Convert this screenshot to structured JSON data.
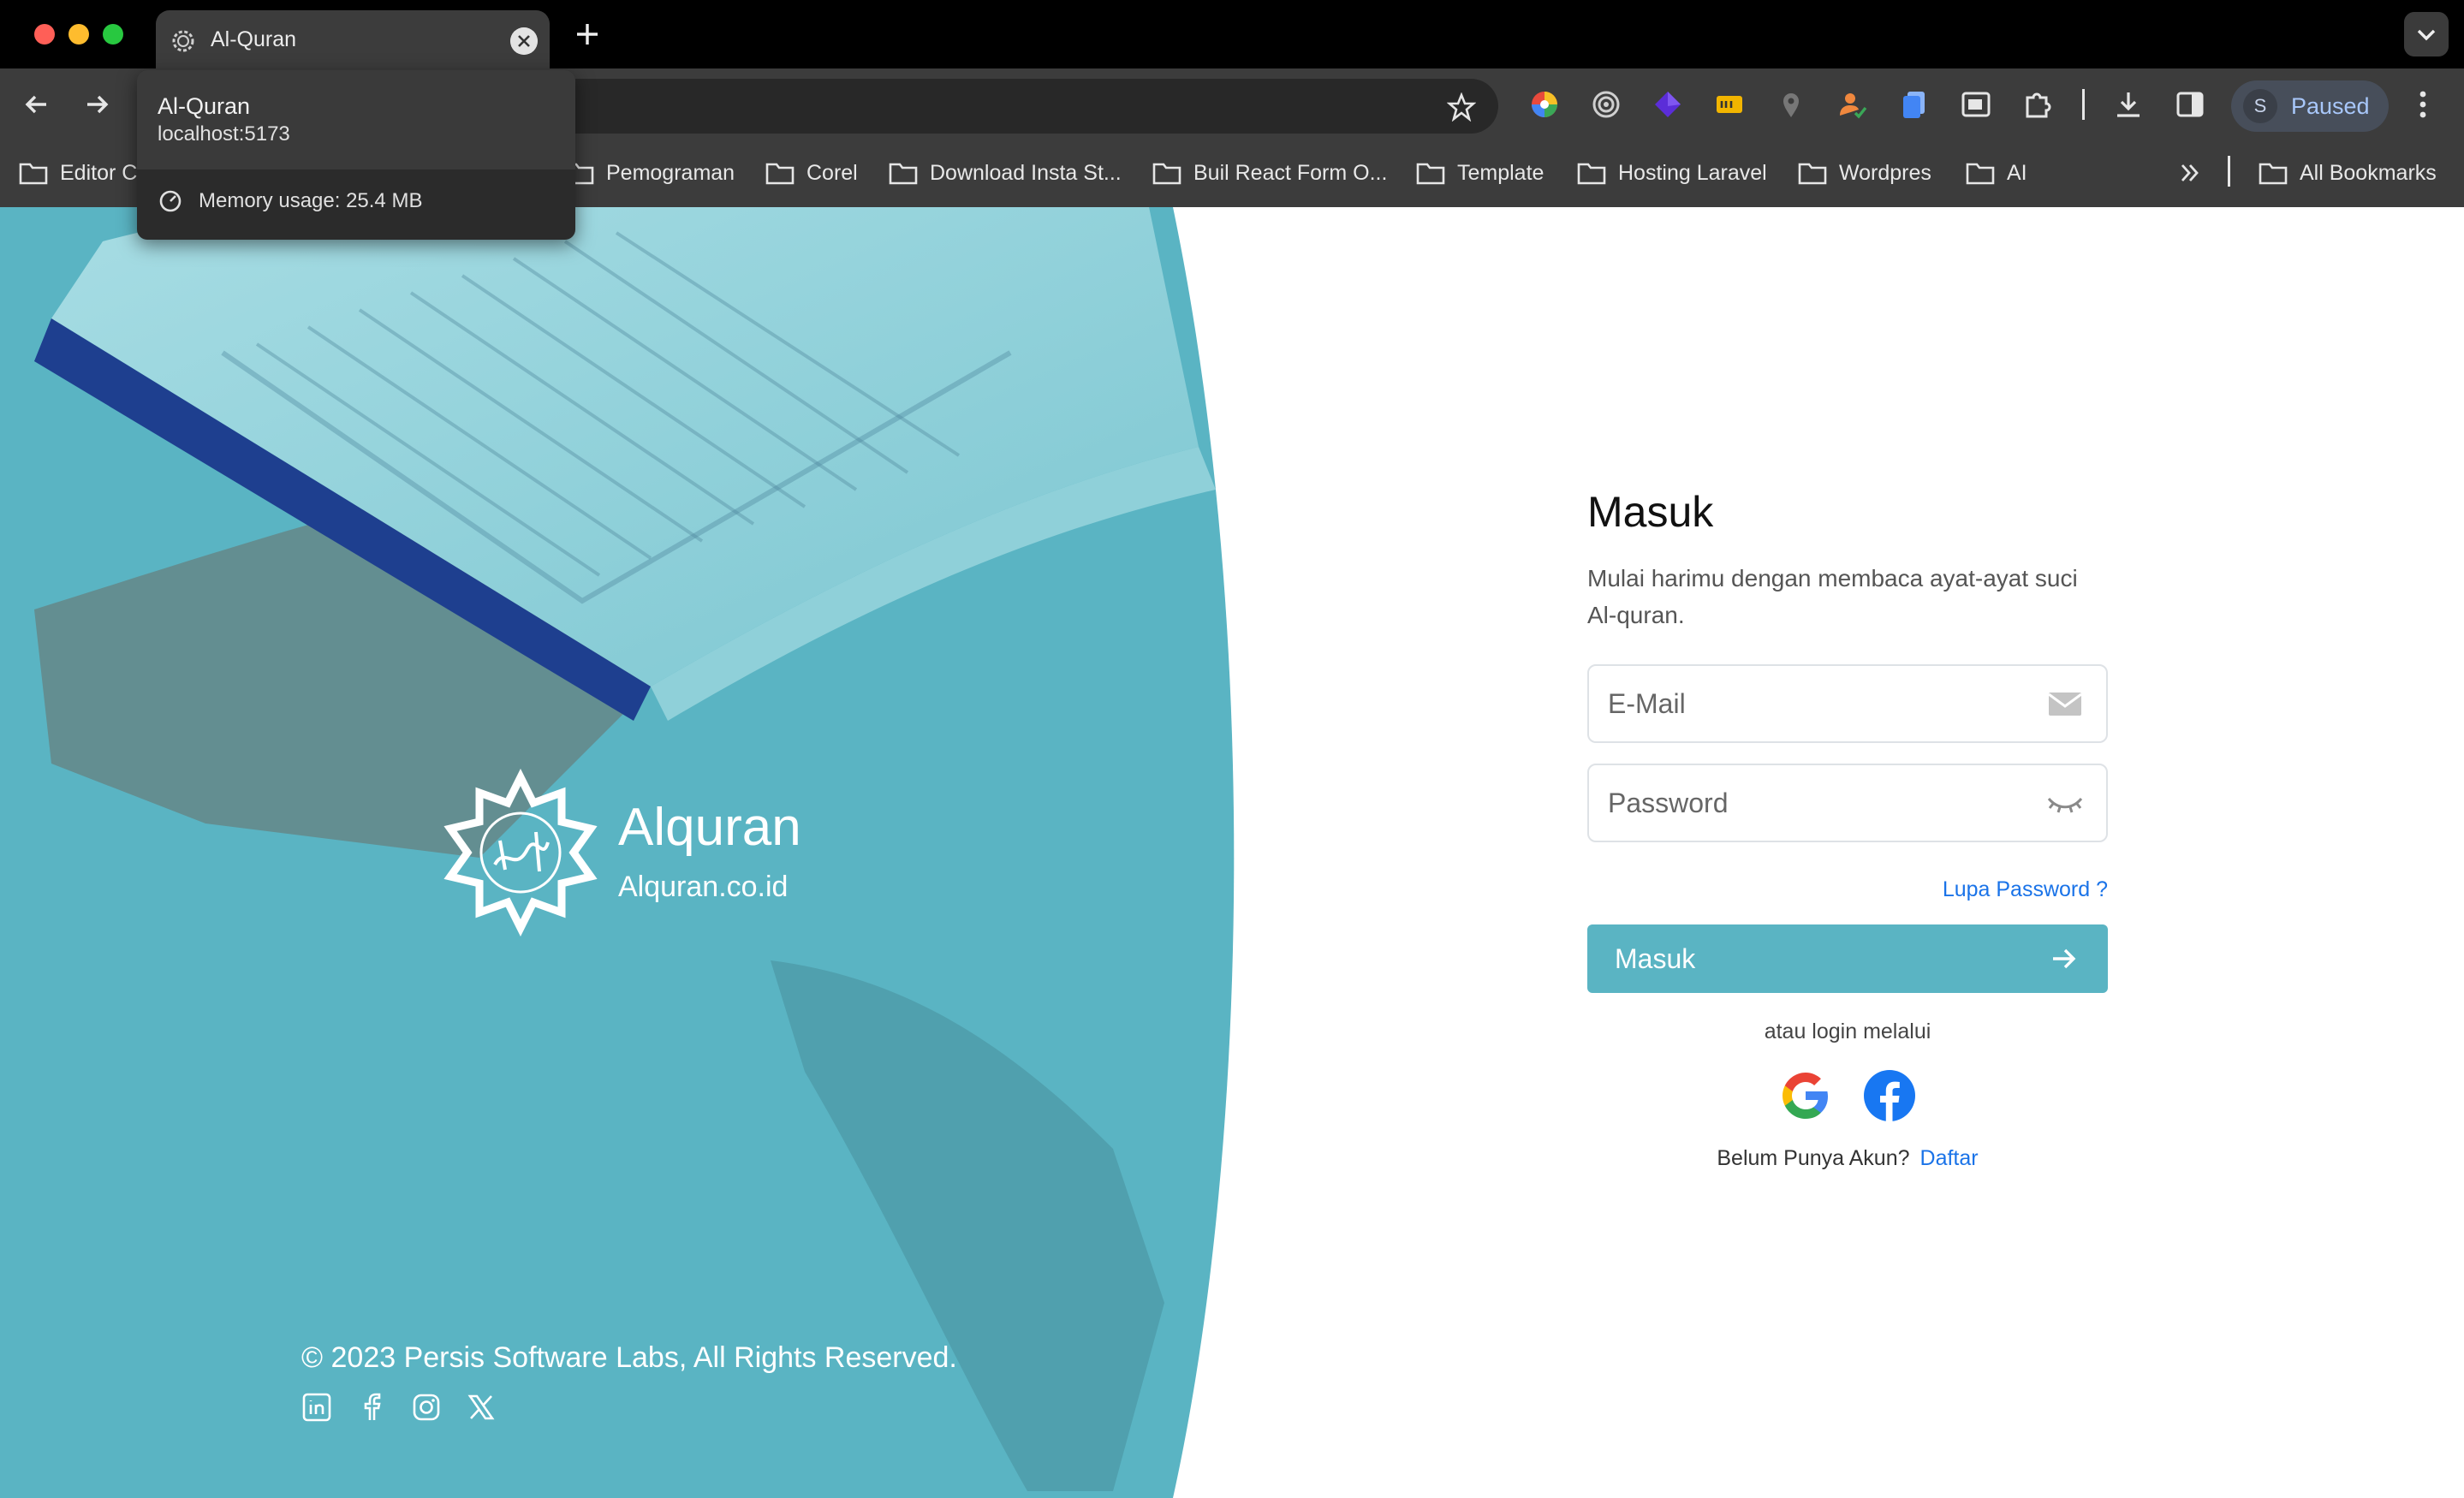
{
  "browser": {
    "tab_title": "Al-Quran",
    "hovercard": {
      "title": "Al-Quran",
      "url": "localhost:5173",
      "memory": "Memory usage: 25.4 MB"
    },
    "profile": {
      "initial": "S",
      "status": "Paused"
    },
    "bookmarks": [
      "Editor C",
      "Pemograman",
      "Corel",
      "Download Insta St...",
      "Buil React Form O...",
      "Template",
      "Hosting Laravel",
      "Wordpres",
      "AI"
    ],
    "all_bookmarks": "All Bookmarks",
    "extension_icons": [
      "color-wheel-icon",
      "target-icon",
      "gem-icon",
      "tag-icon",
      "pin-icon",
      "user-check-icon",
      "docs-icon",
      "window-icon",
      "puzzle-icon"
    ]
  },
  "hero": {
    "brand_name": "Alquran",
    "brand_domain": "Alquran.co.id",
    "copyright": "© 2023 Persis Software Labs, All Rights Reserved.",
    "social_icons": [
      "linkedin-icon",
      "facebook-icon",
      "instagram-icon",
      "x-icon"
    ],
    "background_color": "#5ab4c3"
  },
  "login": {
    "title": "Masuk",
    "subtitle": "Mulai harimu dengan membaca ayat-ayat suci Al-quran.",
    "email_placeholder": "E-Mail",
    "password_placeholder": "Password",
    "forgot_label": "Lupa Password ?",
    "submit_label": "Masuk",
    "alt_label": "atau login melalui",
    "signup_text": "Belum Punya Akun?",
    "signup_link": "Daftar",
    "accent_color": "#5ab4c3",
    "link_color": "#1a73e8"
  }
}
